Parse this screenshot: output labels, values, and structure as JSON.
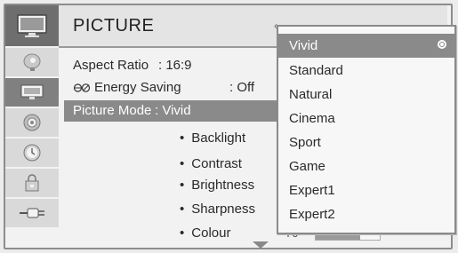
{
  "header": {
    "title": "PICTURE",
    "key_hint": "‹"
  },
  "sidebar": {
    "items": [
      {
        "icon": "tv-icon"
      },
      {
        "icon": "satellite-dish-icon"
      },
      {
        "icon": "monitor-icon"
      },
      {
        "icon": "speaker-icon"
      },
      {
        "icon": "clock-icon"
      },
      {
        "icon": "lock-icon"
      },
      {
        "icon": "input-plug-icon"
      }
    ]
  },
  "menu": {
    "aspect_ratio": {
      "label": "Aspect Ratio",
      "value": ": 16:9"
    },
    "energy_saving": {
      "icon": "eco-energy-icon",
      "label": "Energy Saving",
      "value": ": Off"
    },
    "picture_mode": {
      "label": "Picture Mode",
      "value": ": Vivid"
    },
    "sub_items": [
      {
        "label": "Backlight",
        "value": ""
      },
      {
        "label": "Contrast",
        "value": ""
      },
      {
        "label": "Brightness",
        "value": ""
      },
      {
        "label": "Sharpness",
        "value": ""
      },
      {
        "label": "Colour",
        "value": "70"
      }
    ],
    "colour_level": 0.7
  },
  "dropdown": {
    "selected": "Vivid",
    "options": [
      "Vivid",
      "Standard",
      "Natural",
      "Cinema",
      "Sport",
      "Game",
      "Expert1",
      "Expert2"
    ]
  },
  "colors": {
    "background": "#f2f2f2",
    "selection": "#8a8a8a"
  }
}
